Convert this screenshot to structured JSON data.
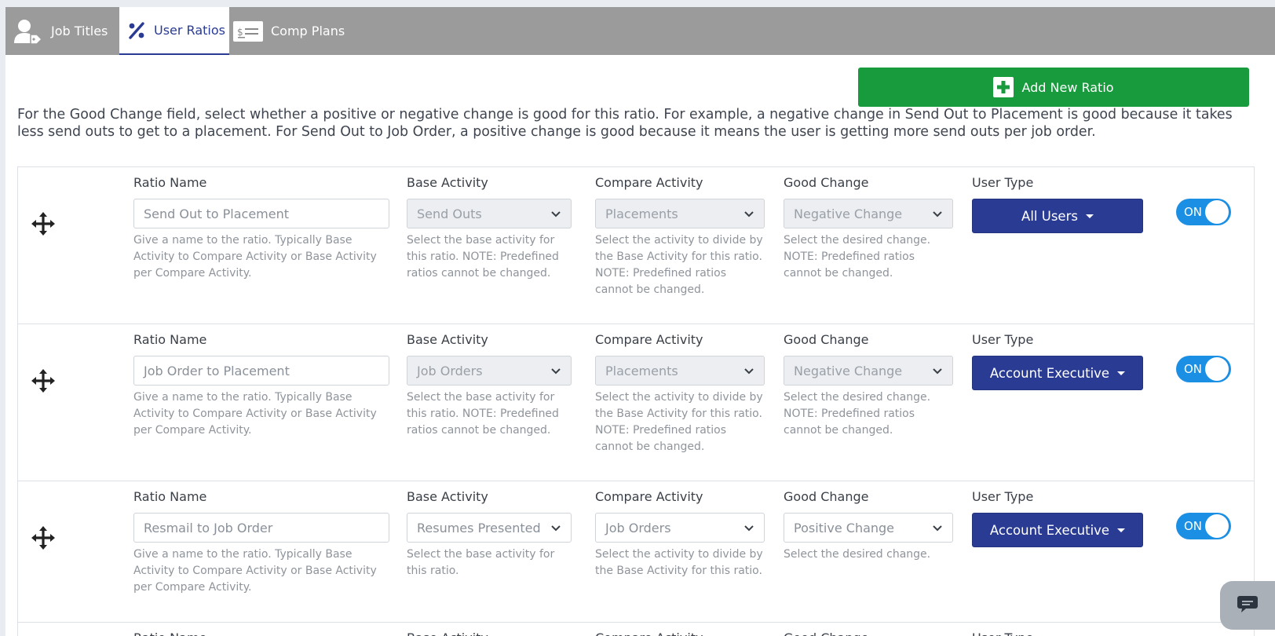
{
  "tabs": [
    {
      "label": "Job Titles",
      "icon": "user-tag-icon",
      "active": false
    },
    {
      "label": "User Ratios",
      "icon": "percent-icon",
      "active": true
    },
    {
      "label": "Comp Plans",
      "icon": "money-check-icon",
      "active": false
    }
  ],
  "toolbar": {
    "add_label": "Add New Ratio",
    "add_icon": "plus-square-icon"
  },
  "intro_text": "For the Good Change field, select whether a positive or negative change is good for this ratio. For example, a negative change in Send Out to Placement is good because it takes less send outs to get to a placement. For Send Out to Job Order, a positive change is good because it means the user is getting more send outs per job order.",
  "columns": {
    "ratio_name": "Ratio Name",
    "base_activity": "Base Activity",
    "compare_activity": "Compare Activity",
    "good_change": "Good Change",
    "user_type": "User Type"
  },
  "rows": [
    {
      "ratio_name_placeholder": "Send Out to Placement",
      "ratio_help": "Give a name to the ratio. Typically Base Activity to Compare Activity or Base Activity per Compare Activity.",
      "base_activity": "Send Outs",
      "base_help": "Select the base activity for this ratio. NOTE: Predefined ratios cannot be changed.",
      "compare_activity": "Placements",
      "compare_help": "Select the activity to divide by the Base Activity for this ratio. NOTE: Predefined ratios cannot be changed.",
      "good_change": "Negative Change",
      "good_help": "Select the desired change. NOTE: Predefined ratios cannot be changed.",
      "user_type": "All Users",
      "toggle": "ON",
      "predefined": true
    },
    {
      "ratio_name_placeholder": "Job Order to Placement",
      "ratio_help": "Give a name to the ratio. Typically Base Activity to Compare Activity or Base Activity per Compare Activity.",
      "base_activity": "Job Orders",
      "base_help": "Select the base activity for this ratio. NOTE: Predefined ratios cannot be changed.",
      "compare_activity": "Placements",
      "compare_help": "Select the activity to divide by the Base Activity for this ratio. NOTE: Predefined ratios cannot be changed.",
      "good_change": "Negative Change",
      "good_help": "Select the desired change. NOTE: Predefined ratios cannot be changed.",
      "user_type": "Account Executive",
      "toggle": "ON",
      "predefined": true
    },
    {
      "ratio_name_placeholder": "Resmail to Job Order",
      "ratio_help": "Give a name to the ratio. Typically Base Activity to Compare Activity or Base Activity per Compare Activity.",
      "base_activity": "Resumes Presented",
      "base_help": "Select the base activity for this ratio.",
      "compare_activity": "Job Orders",
      "compare_help": "Select the activity to divide by the Base Activity for this ratio.",
      "good_change": "Positive Change",
      "good_help": "Select the desired change.",
      "user_type": "Account Executive",
      "toggle": "ON",
      "predefined": false
    }
  ],
  "colors": {
    "tabbar": "#9b9b9b",
    "active_tab_text": "#2a3b93",
    "add_button": "#179b3c",
    "user_type_button": "#2a3b93",
    "toggle_on": "#1a8fe3"
  },
  "chat": {
    "icon": "chat-bubble-icon"
  }
}
